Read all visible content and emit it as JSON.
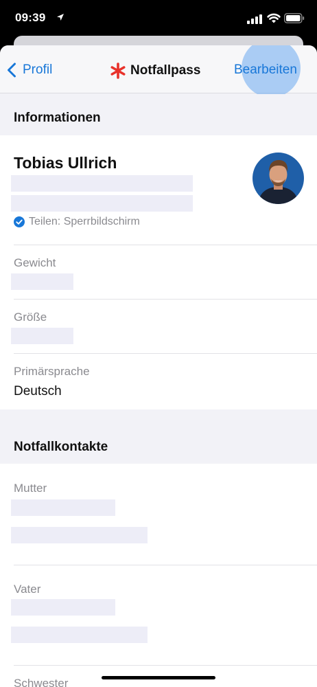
{
  "status_bar": {
    "time": "09:39"
  },
  "nav": {
    "back_label": "Profil",
    "title": "Notfallpass",
    "edit_label": "Bearbeiten"
  },
  "colors": {
    "accent": "#1877d8",
    "asterisk": "#e8312a",
    "background": "#f2f2f7"
  },
  "sections": {
    "info_title": "Informationen",
    "contacts_title": "Notfallkontakte"
  },
  "profile": {
    "name": "Tobias Ullrich",
    "share_label": "Teilen: Sperrbildschirm"
  },
  "fields": {
    "weight_label": "Gewicht",
    "height_label": "Größe",
    "language_label": "Primärsprache",
    "language_value": "Deutsch"
  },
  "contacts": {
    "mother_label": "Mutter",
    "father_label": "Vater",
    "sister_label": "Schwester"
  }
}
